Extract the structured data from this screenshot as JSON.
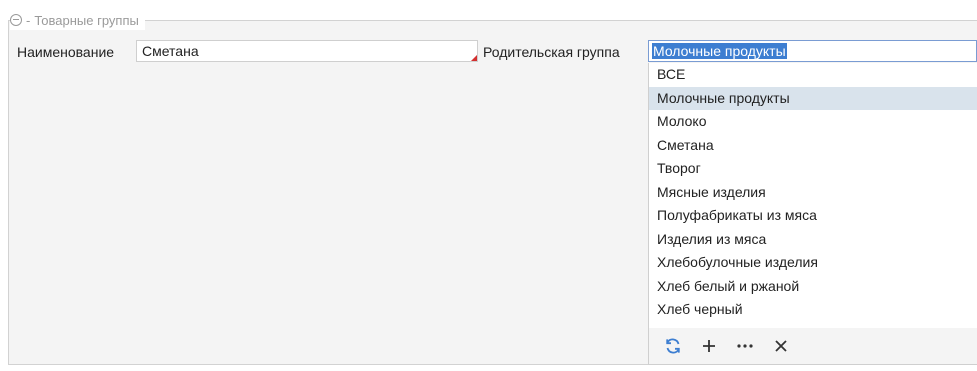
{
  "group": {
    "title": "Товарные группы",
    "separator": "-"
  },
  "form": {
    "name_label": "Наименование",
    "name_value": "Сметана",
    "parent_label": "Родительская группа",
    "parent_value": "Молочные продукты"
  },
  "dropdown": {
    "items": [
      "ВСЕ",
      "Молочные продукты",
      "Молоко",
      "Сметана",
      "Творог",
      "Мясные изделия",
      "Полуфабрикаты из мяса",
      "Изделия из мяса",
      "Хлебобулочные изделия",
      "Хлеб белый и ржаной",
      "Хлеб черный"
    ],
    "selected_index": 1,
    "toolbar": [
      {
        "icon": "refresh-icon"
      },
      {
        "icon": "plus-icon"
      },
      {
        "icon": "more-icon"
      },
      {
        "icon": "close-icon"
      }
    ]
  },
  "colors": {
    "accent": "#3d7ed1",
    "selected_row": "#d9e3ec",
    "refresh_icon": "#3d7ed1",
    "required_marker": "#d32f2f"
  }
}
